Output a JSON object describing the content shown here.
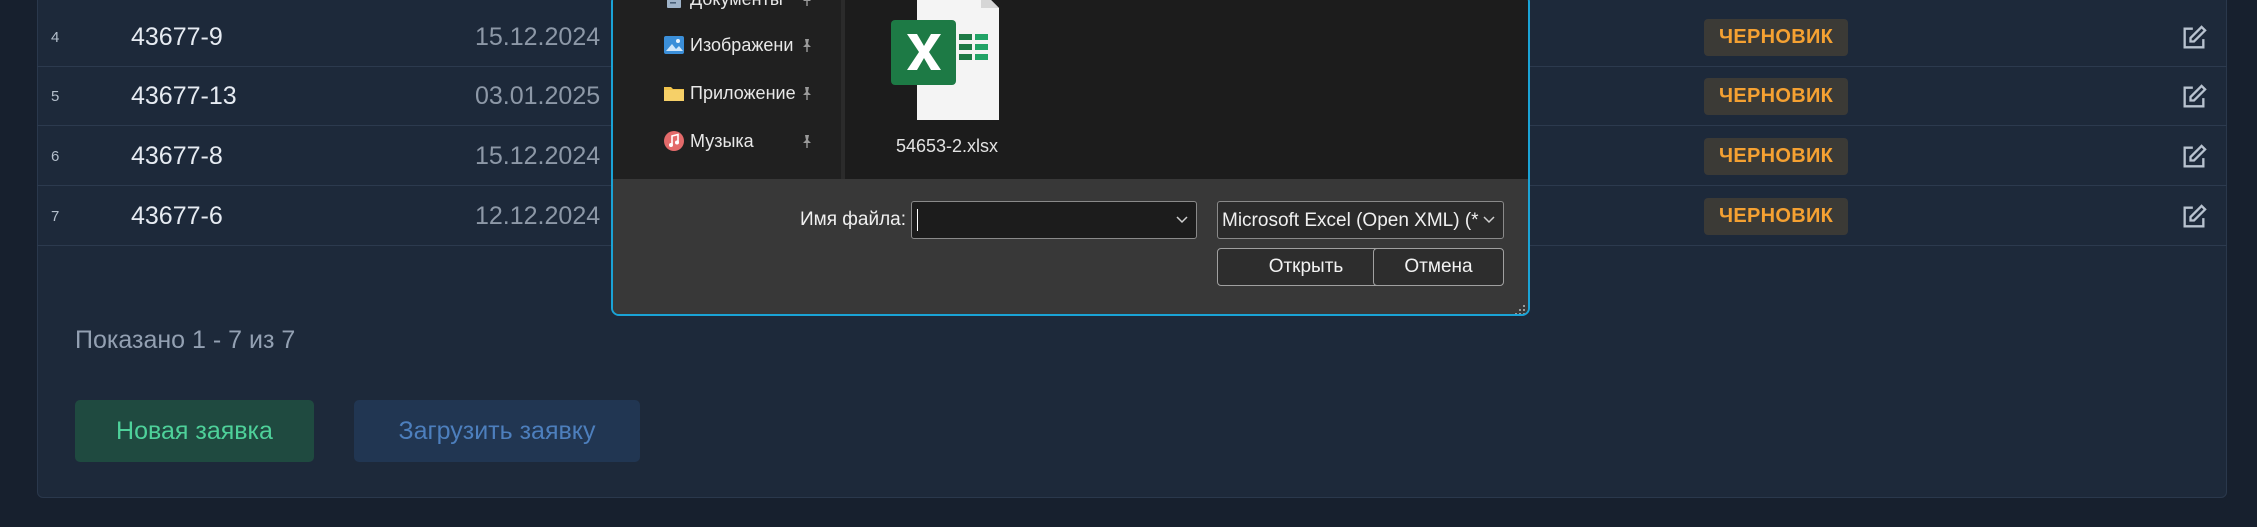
{
  "table": {
    "rows": [
      {
        "num": "4",
        "code": "43677-9",
        "date": "15.12.2024",
        "status": "ЧЕРНОВИК"
      },
      {
        "num": "5",
        "code": "43677-13",
        "date": "03.01.2025",
        "status": "ЧЕРНОВИК"
      },
      {
        "num": "6",
        "code": "43677-8",
        "date": "15.12.2024",
        "status": "ЧЕРНОВИК"
      },
      {
        "num": "7",
        "code": "43677-6",
        "date": "12.12.2024",
        "status": "ЧЕРНОВИК"
      }
    ]
  },
  "footer": {
    "shown_text": "Показано 1 - 7 из 7",
    "new_request": "Новая заявка",
    "upload_request": "Загрузить заявку"
  },
  "dialog": {
    "nav": [
      {
        "label": "Документы",
        "icon": "documents-icon"
      },
      {
        "label": "Изображени",
        "icon": "pictures-icon"
      },
      {
        "label": "Приложение",
        "icon": "folder-icon"
      },
      {
        "label": "Музыка",
        "icon": "music-icon"
      }
    ],
    "file": {
      "name": "54653-2.xlsx",
      "icon": "excel-file-icon"
    },
    "filename_label": "Имя файла:",
    "filename_value": "",
    "filetype_value": "Microsoft Excel (Open XML) (*",
    "open_label": "Открыть",
    "cancel_label": "Отмена"
  },
  "colors": {
    "status_badge_text": "#f5a132",
    "dialog_focus_border": "#1aa3d6",
    "new_button_text": "#4ed19a",
    "upload_button_text": "#4d7fbd"
  }
}
